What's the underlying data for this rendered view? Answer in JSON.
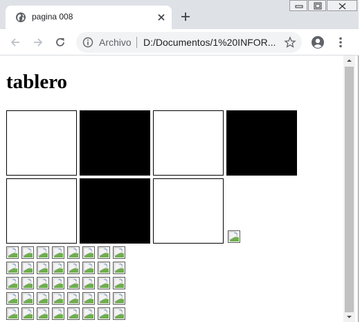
{
  "browser": {
    "tab": {
      "title": "pagina 008",
      "favicon": "globe-icon",
      "close_icon": "close-icon"
    },
    "new_tab_icon": "plus-icon",
    "window_controls": [
      "minimize-icon",
      "restore-icon",
      "close-icon"
    ],
    "nav": [
      "back-arrow-icon",
      "forward-arrow-icon",
      "reload-icon"
    ],
    "omnibox": {
      "security_icon": "info-icon",
      "chip_label": "Archivo",
      "url": "D:/Documentos/1%20INFOR...",
      "bookmark_icon": "star-icon"
    },
    "profile_icon": "account-circle-icon",
    "menu_icon": "three-dot-menu-icon"
  },
  "page": {
    "heading": "tablero",
    "board": {
      "rows": [
        [
          "white",
          "black",
          "white",
          "black"
        ],
        [
          "white",
          "black",
          "white"
        ]
      ],
      "trailing_image": "broken-image-icon"
    },
    "image_grid": {
      "columns": 8,
      "visible_rows": 5,
      "icon": "broken-image-icon"
    }
  },
  "colors": {
    "tabstrip": "#dee1e6",
    "omnibox": "#f1f3f4",
    "square_white": "#ffffff",
    "square_black": "#000000",
    "scrollbar_thumb": "#c1c1c1"
  }
}
